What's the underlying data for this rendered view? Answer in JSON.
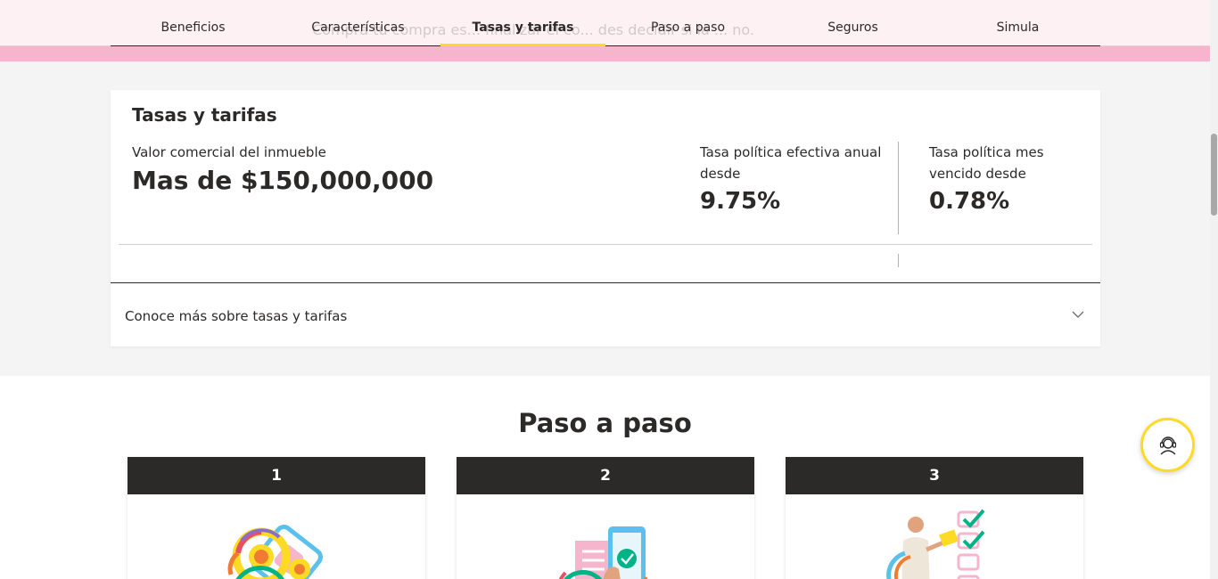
{
  "nav": {
    "ghost_text": "Compra tu compra es... finalizar el co... des decidir si la ... no.",
    "tabs": [
      {
        "label": "Beneficios",
        "active": false
      },
      {
        "label": "Características",
        "active": false
      },
      {
        "label": "Tasas y tarifas",
        "active": true
      },
      {
        "label": "Paso a paso",
        "active": false
      },
      {
        "label": "Seguros",
        "active": false
      },
      {
        "label": "Simula",
        "active": false
      }
    ]
  },
  "rates": {
    "title": "Tasas y tarifas",
    "property_label": "Valor comercial del inmueble",
    "property_value": "Mas de $150,000,000",
    "annual_label": "Tasa política efectiva anual desde",
    "annual_value": "9.75%",
    "monthly_label": "Tasa política mes vencido desde",
    "monthly_value": "0.78%",
    "accordion_label": "Conoce más sobre tasas y tarifas"
  },
  "steps_section": {
    "title": "Paso a paso",
    "steps": [
      {
        "number": "1",
        "illustration": "house-keys-illustration"
      },
      {
        "number": "2",
        "illustration": "phone-approval-illustration"
      },
      {
        "number": "3",
        "illustration": "checklist-person-illustration"
      }
    ]
  },
  "help": {
    "icon": "support-agent-icon"
  },
  "colors": {
    "accent_yellow": "#fdda24",
    "pink": "#f5b6cd",
    "dark": "#2c2a29"
  }
}
